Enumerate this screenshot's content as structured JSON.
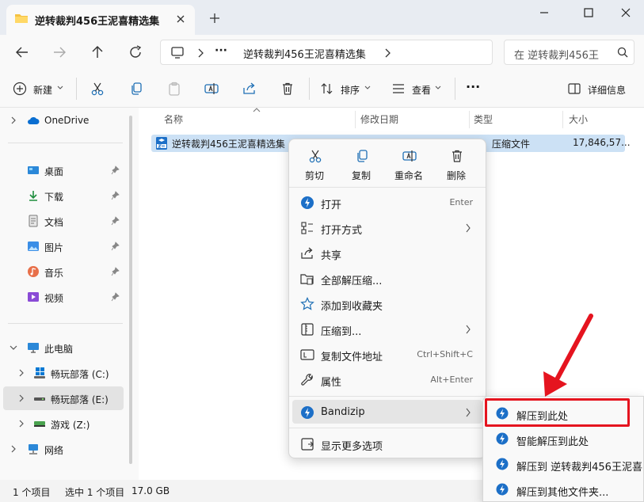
{
  "window": {
    "tab_title": "逆转裁判456王泥喜精选集"
  },
  "address": {
    "more": "···",
    "crumb": "逆转裁判456王泥喜精选集",
    "search_placeholder": "在 逆转裁判456王"
  },
  "toolbar": {
    "new_label": "新建",
    "sort_label": "排序",
    "view_label": "查看",
    "more": "···",
    "details_label": "详细信息"
  },
  "sidebar": {
    "onedrive": "OneDrive",
    "quick": [
      {
        "label": "桌面"
      },
      {
        "label": "下载"
      },
      {
        "label": "文档"
      },
      {
        "label": "图片"
      },
      {
        "label": "音乐"
      },
      {
        "label": "视频"
      }
    ],
    "this_pc": "此电脑",
    "drives": [
      {
        "label": "畅玩部落 (C:)"
      },
      {
        "label": "畅玩部落 (E:)"
      },
      {
        "label": "游戏 (Z:)"
      }
    ],
    "network": "网络"
  },
  "columns": {
    "name": "名称",
    "modified": "修改日期",
    "type": "类型",
    "size": "大小"
  },
  "file": {
    "name": "逆转裁判456王泥喜精选集",
    "type": "压缩文件",
    "size": "17,846,57..."
  },
  "context_menu": {
    "quick_actions": [
      {
        "label": "剪切"
      },
      {
        "label": "复制"
      },
      {
        "label": "重命名"
      },
      {
        "label": "删除"
      }
    ],
    "items": [
      {
        "label": "打开",
        "shortcut": "Enter"
      },
      {
        "label": "打开方式"
      },
      {
        "label": "共享"
      },
      {
        "label": "全部解压缩..."
      },
      {
        "label": "添加到收藏夹"
      },
      {
        "label": "压缩到..."
      },
      {
        "label": "复制文件地址",
        "shortcut": "Ctrl+Shift+C"
      },
      {
        "label": "属性",
        "shortcut": "Alt+Enter"
      }
    ],
    "bandizip": "Bandizip",
    "more_options": "显示更多选项"
  },
  "submenu": {
    "items": [
      {
        "label": "解压到此处"
      },
      {
        "label": "智能解压到此处"
      },
      {
        "label": "解压到 逆转裁判456王泥喜"
      },
      {
        "label": "解压到其他文件夹..."
      }
    ]
  },
  "status": {
    "count": "1 个项目",
    "selected": "选中 1 个项目",
    "size": "17.0 GB"
  },
  "colors": {
    "accent": "#0067c0",
    "selection": "#cce1f5",
    "annotation_red": "#e5141f"
  }
}
